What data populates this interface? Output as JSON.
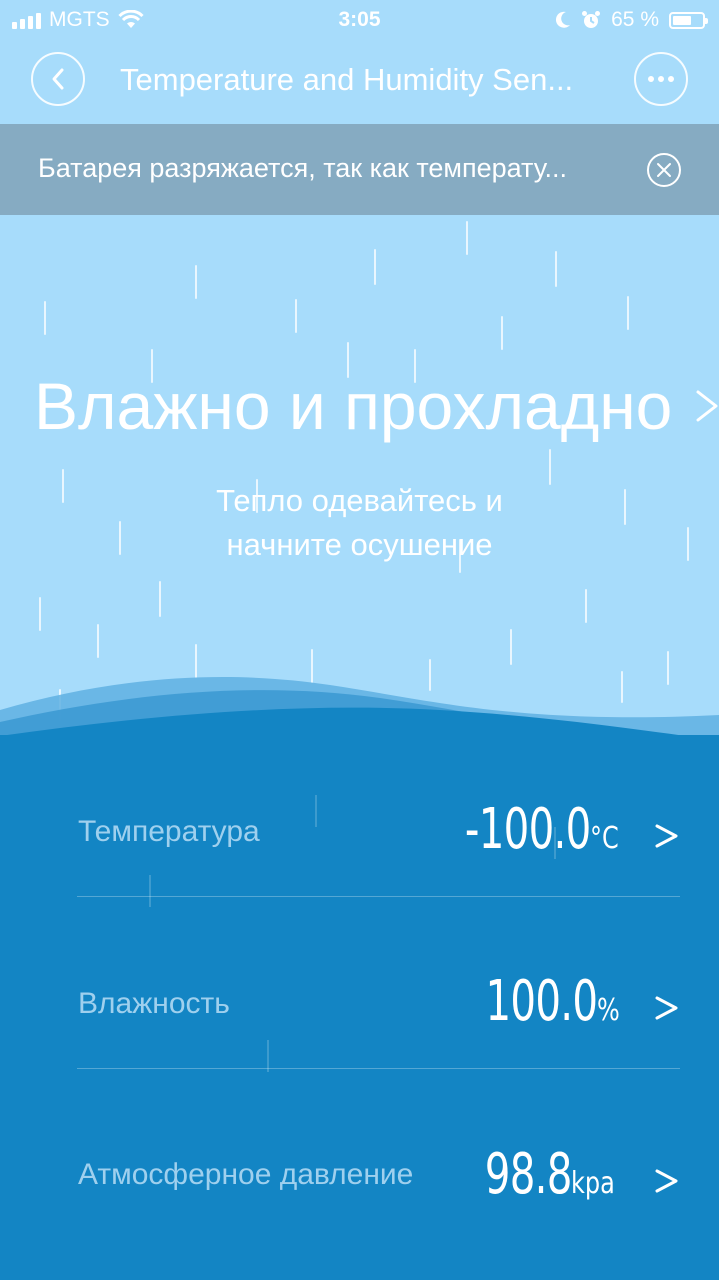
{
  "status_bar": {
    "carrier": "MGTS",
    "time": "3:05",
    "battery_percent": "65 %",
    "battery_level": 0.65
  },
  "nav": {
    "title": "Temperature and Humidity Sen...",
    "back_icon": "chevron-left-icon",
    "more_icon": "more-horizontal-icon"
  },
  "banner": {
    "text": "Батарея разряжается, так как температу...",
    "close_icon": "close-circle-icon"
  },
  "hero": {
    "title": "Влажно и прохладно",
    "subtitle_line1": "Тепло одевайтесь и",
    "subtitle_line2": "начните осушение"
  },
  "readings": [
    {
      "label": "Температура",
      "value": "-100.0",
      "unit": "°C"
    },
    {
      "label": "Влажность",
      "value": "100.0",
      "unit": "%"
    },
    {
      "label": "Атмосферное давление",
      "value": "98.8",
      "unit": "kpa"
    }
  ],
  "colors": {
    "sky": "#a7dcfb",
    "banner": "#86abc2",
    "panel": "#1385c4",
    "label": "#9fd0ee"
  }
}
